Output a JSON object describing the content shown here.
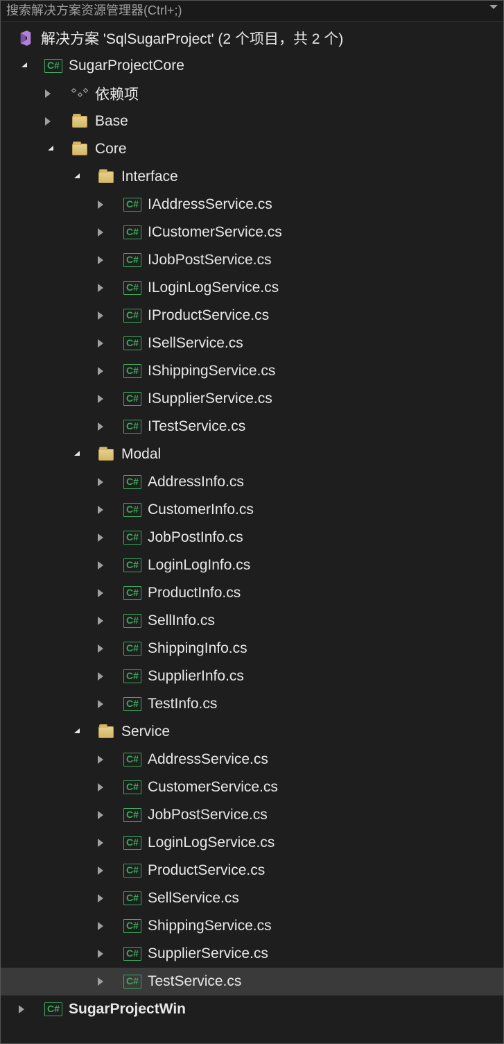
{
  "search_placeholder": "搜索解决方案资源管理器(Ctrl+;)",
  "solution": {
    "label": "解决方案 'SqlSugarProject' (2 个项目，共 2 个)",
    "projects": [
      {
        "name": "SugarProjectCore",
        "icon": "C#",
        "expanded": true,
        "bold": false,
        "children": [
          {
            "type": "dep",
            "name": "依赖项",
            "expanded": false
          },
          {
            "type": "folder",
            "name": "Base",
            "expanded": false
          },
          {
            "type": "folder",
            "name": "Core",
            "expanded": true,
            "children": [
              {
                "type": "folder",
                "name": "Interface",
                "expanded": true,
                "files": [
                  "IAddressService.cs",
                  "ICustomerService.cs",
                  "IJobPostService.cs",
                  "ILoginLogService.cs",
                  "IProductService.cs",
                  "ISellService.cs",
                  "IShippingService.cs",
                  "ISupplierService.cs",
                  "ITestService.cs"
                ]
              },
              {
                "type": "folder",
                "name": "Modal",
                "expanded": true,
                "files": [
                  "AddressInfo.cs",
                  "CustomerInfo.cs",
                  "JobPostInfo.cs",
                  "LoginLogInfo.cs",
                  "ProductInfo.cs",
                  "SellInfo.cs",
                  "ShippingInfo.cs",
                  "SupplierInfo.cs",
                  "TestInfo.cs"
                ]
              },
              {
                "type": "folder",
                "name": "Service",
                "expanded": true,
                "files": [
                  "AddressService.cs",
                  "CustomerService.cs",
                  "JobPostService.cs",
                  "LoginLogService.cs",
                  "ProductService.cs",
                  "SellService.cs",
                  "ShippingService.cs",
                  "SupplierService.cs",
                  "TestService.cs"
                ]
              }
            ]
          }
        ]
      },
      {
        "name": "SugarProjectWin",
        "icon": "C#",
        "expanded": false,
        "bold": true
      }
    ]
  },
  "selected_file": "TestService.cs",
  "cs_badge": "C#"
}
